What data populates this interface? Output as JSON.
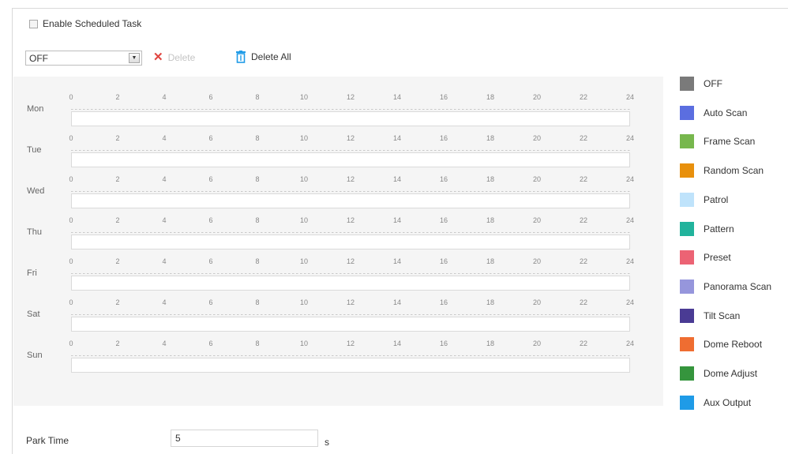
{
  "enable_label": "Enable Scheduled Task",
  "toolbar": {
    "mode_select_value": "OFF",
    "delete_label": "Delete",
    "delete_all_label": "Delete All"
  },
  "days": [
    "Mon",
    "Tue",
    "Wed",
    "Thu",
    "Fri",
    "Sat",
    "Sun"
  ],
  "hour_ticks": [
    "0",
    "2",
    "4",
    "6",
    "8",
    "10",
    "12",
    "14",
    "16",
    "18",
    "20",
    "22",
    "24"
  ],
  "legend": [
    {
      "label": "OFF",
      "color": "#7a7a7a"
    },
    {
      "label": "Auto Scan",
      "color": "#5b6ee0"
    },
    {
      "label": "Frame Scan",
      "color": "#77b74d"
    },
    {
      "label": "Random Scan",
      "color": "#e8900c"
    },
    {
      "label": "Patrol",
      "color": "#bfe3fb"
    },
    {
      "label": "Pattern",
      "color": "#21b39c"
    },
    {
      "label": "Preset",
      "color": "#ec6374"
    },
    {
      "label": "Panorama Scan",
      "color": "#9696dc"
    },
    {
      "label": "Tilt Scan",
      "color": "#4a3b94"
    },
    {
      "label": "Dome Reboot",
      "color": "#ef6d31"
    },
    {
      "label": "Dome Adjust",
      "color": "#35953d"
    },
    {
      "label": "Aux Output",
      "color": "#1f9be7"
    }
  ],
  "park_time": {
    "label": "Park Time",
    "value": "5",
    "unit": "s"
  }
}
